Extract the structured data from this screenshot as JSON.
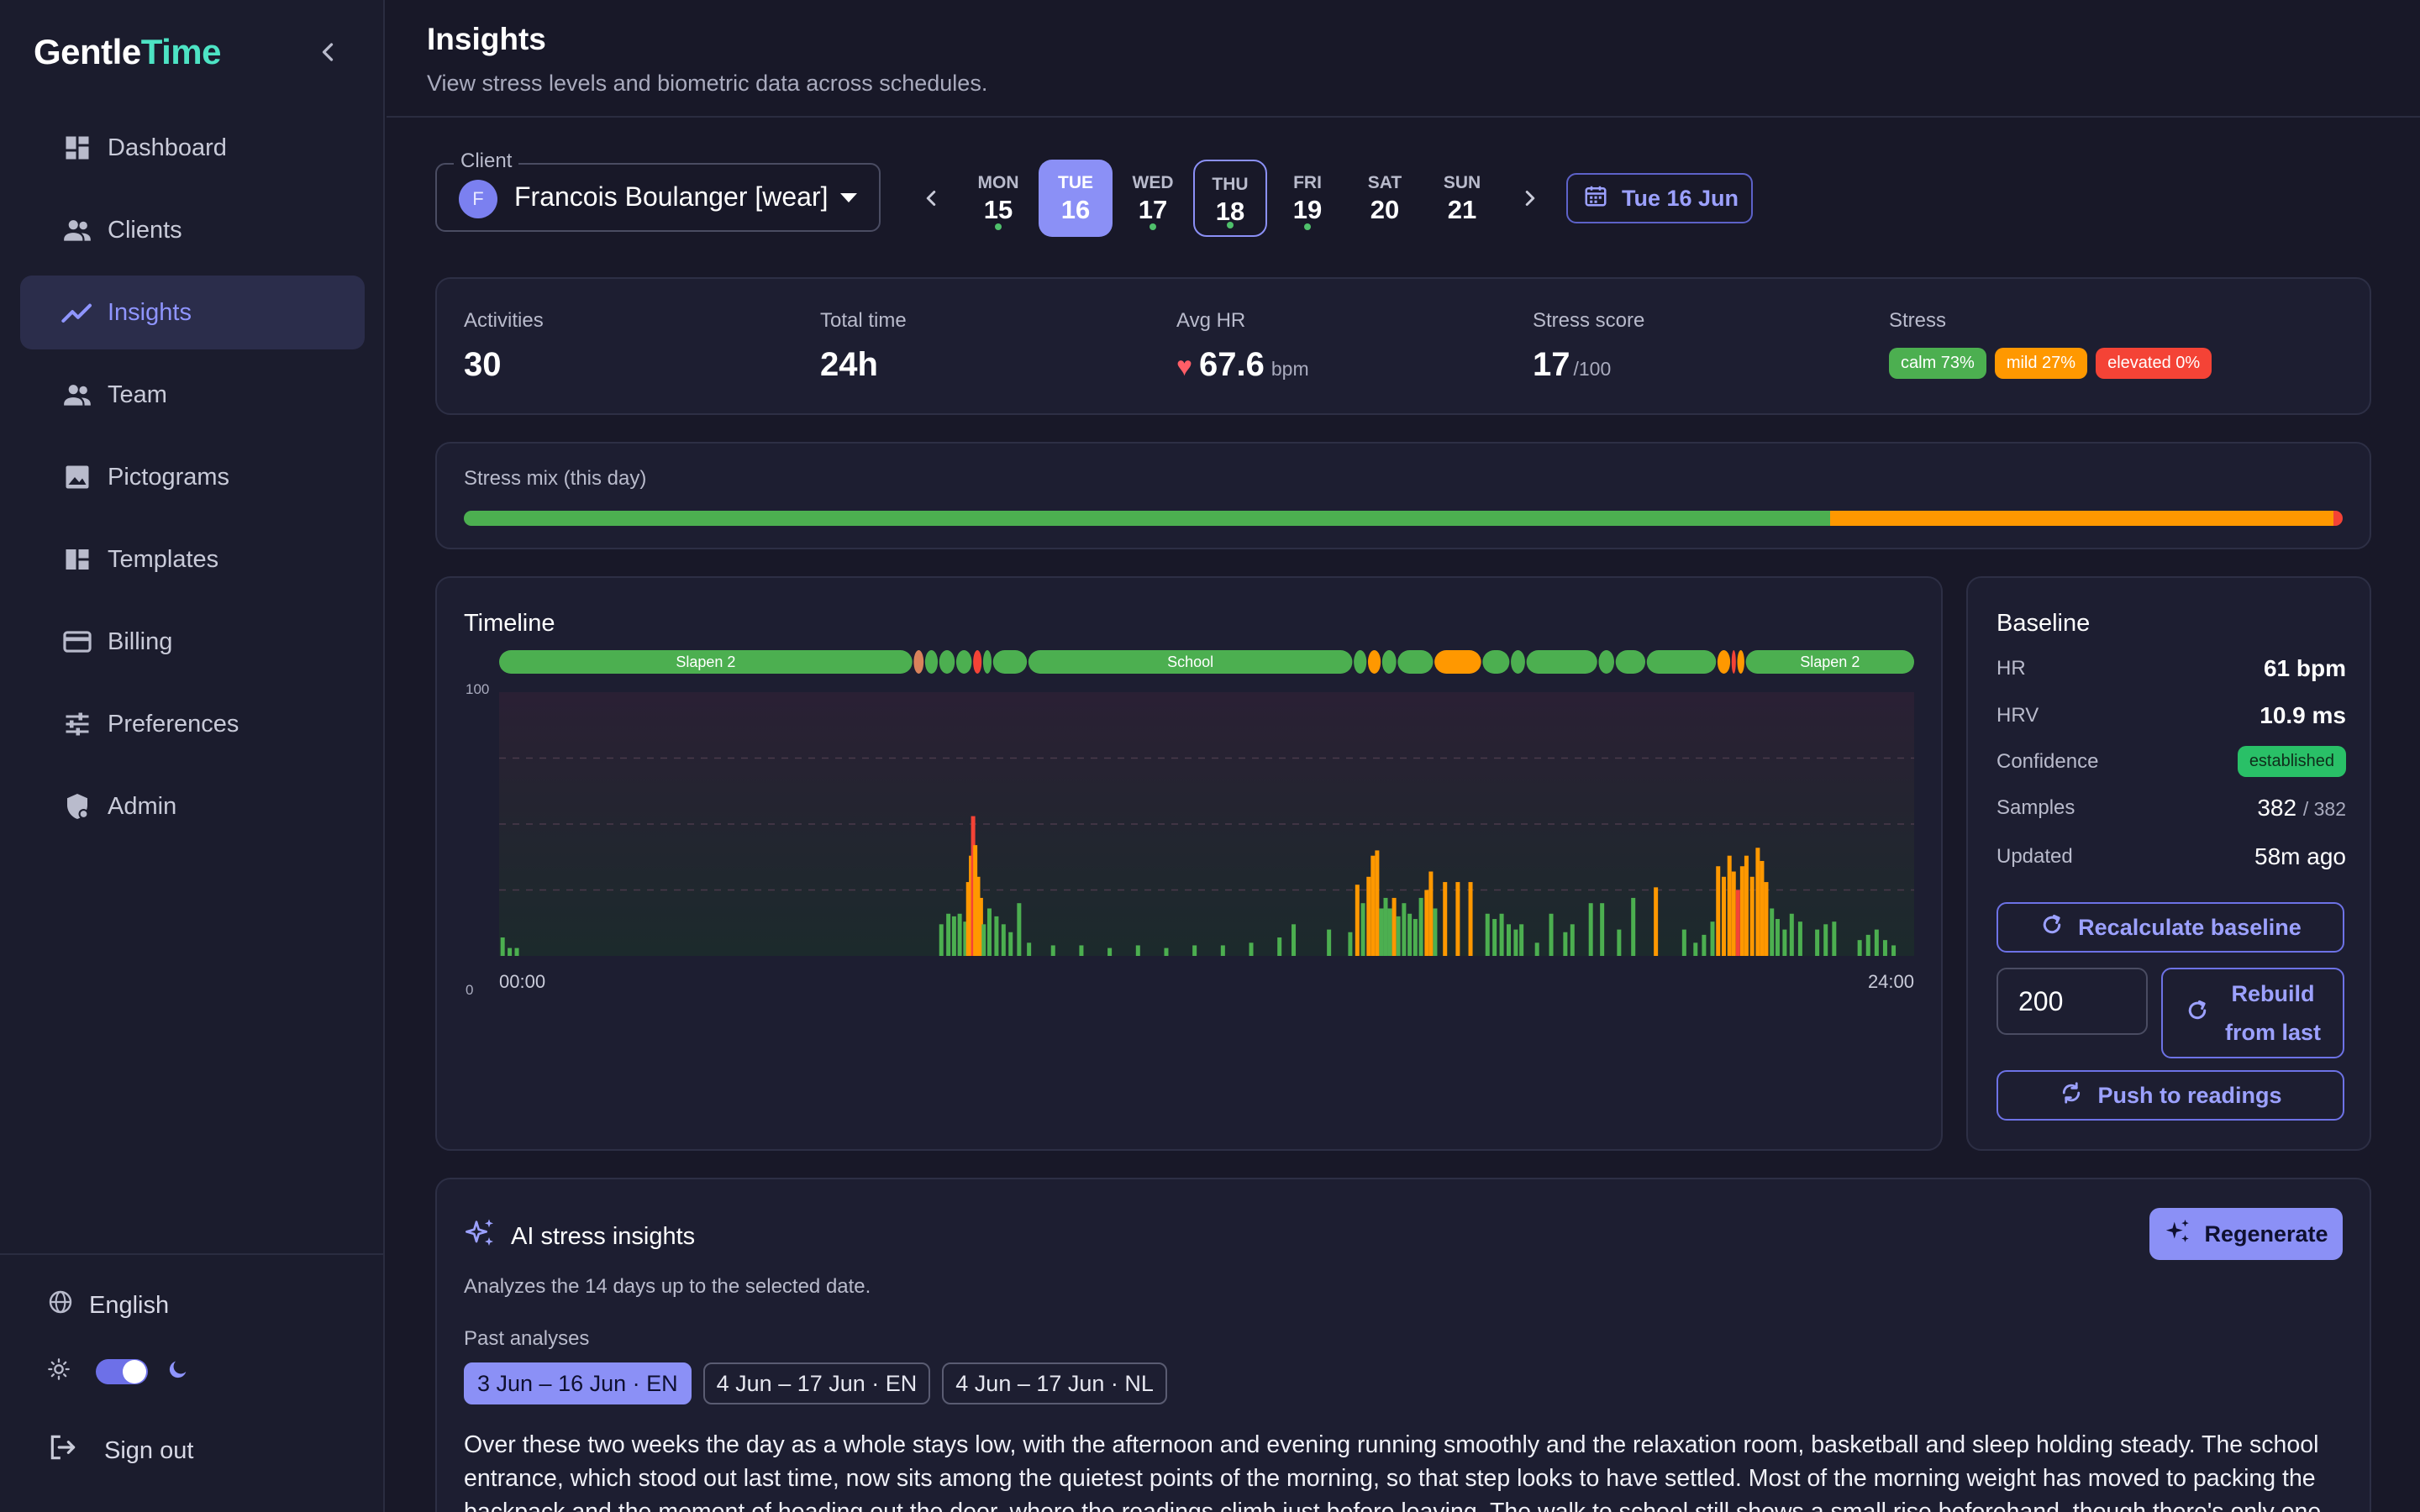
{
  "brand": {
    "part1": "Gentle",
    "part2": "Time"
  },
  "sidebar": {
    "items": [
      {
        "label": "Dashboard",
        "icon": "dashboard-icon"
      },
      {
        "label": "Clients",
        "icon": "people-icon"
      },
      {
        "label": "Insights",
        "icon": "trend-icon",
        "active": true
      },
      {
        "label": "Team",
        "icon": "people-icon"
      },
      {
        "label": "Pictograms",
        "icon": "image-icon"
      },
      {
        "label": "Templates",
        "icon": "templates-icon"
      },
      {
        "label": "Billing",
        "icon": "card-icon"
      },
      {
        "label": "Preferences",
        "icon": "sliders-icon"
      },
      {
        "label": "Admin",
        "icon": "shield-icon"
      }
    ],
    "language": "English",
    "sign_out": "Sign out"
  },
  "header": {
    "title": "Insights",
    "subtitle": "View stress levels and biometric data across schedules."
  },
  "client": {
    "label": "Client",
    "initial": "F",
    "name": "Francois Boulanger [wear]"
  },
  "week": {
    "days": [
      {
        "name": "MON",
        "date": "15",
        "dot": true
      },
      {
        "name": "TUE",
        "date": "16",
        "dot": false,
        "selected": true
      },
      {
        "name": "WED",
        "date": "17",
        "dot": true
      },
      {
        "name": "THU",
        "date": "18",
        "dot": true,
        "today": true
      },
      {
        "name": "FRI",
        "date": "19",
        "dot": true
      },
      {
        "name": "SAT",
        "date": "20",
        "dot": false
      },
      {
        "name": "SUN",
        "date": "21",
        "dot": false
      }
    ],
    "current_date": "Tue 16 Jun"
  },
  "stats": {
    "activities": {
      "label": "Activities",
      "value": "30"
    },
    "total_time": {
      "label": "Total time",
      "value": "24h"
    },
    "avg_hr": {
      "label": "Avg HR",
      "value": "67.6",
      "unit": "bpm"
    },
    "stress_score": {
      "label": "Stress score",
      "value": "17",
      "unit": "/100"
    },
    "stress": {
      "label": "Stress",
      "calm": "calm 73%",
      "mild": "mild 27%",
      "elevated": "elevated 0%"
    }
  },
  "colors": {
    "calm": "#4caf50",
    "mild": "#ff9800",
    "elevated": "#f44336",
    "accent": "#8b90f6",
    "brand_accent": "#4de3c4"
  },
  "stress_mix": {
    "title": "Stress mix (this day)",
    "segments": [
      {
        "level": "calm",
        "fraction": 0.727
      },
      {
        "level": "mild",
        "fraction": 0.268
      },
      {
        "level": "elevated",
        "fraction": 0.005
      }
    ]
  },
  "timeline": {
    "title": "Timeline",
    "y_max_label": "100",
    "y_min_label": "0",
    "x_start": "00:00",
    "x_end": "24:00",
    "activities": [
      {
        "start": 0.0,
        "end": 0.292,
        "level": "calm",
        "label": "Slapen 2"
      },
      {
        "start": 0.293,
        "end": 0.3,
        "level": "mildpale",
        "label": ""
      },
      {
        "start": 0.301,
        "end": 0.31,
        "level": "calm",
        "label": ""
      },
      {
        "start": 0.311,
        "end": 0.322,
        "level": "calm",
        "label": ""
      },
      {
        "start": 0.323,
        "end": 0.334,
        "level": "calm",
        "label": ""
      },
      {
        "start": 0.335,
        "end": 0.341,
        "level": "elevated",
        "label": ""
      },
      {
        "start": 0.342,
        "end": 0.348,
        "level": "calm",
        "label": ""
      },
      {
        "start": 0.349,
        "end": 0.373,
        "level": "calm",
        "label": ""
      },
      {
        "start": 0.374,
        "end": 0.603,
        "level": "calm",
        "label": "School"
      },
      {
        "start": 0.604,
        "end": 0.613,
        "level": "calm",
        "label": ""
      },
      {
        "start": 0.614,
        "end": 0.623,
        "level": "mild",
        "label": ""
      },
      {
        "start": 0.624,
        "end": 0.634,
        "level": "calm",
        "label": ""
      },
      {
        "start": 0.635,
        "end": 0.66,
        "level": "calm",
        "label": ""
      },
      {
        "start": 0.661,
        "end": 0.694,
        "level": "mild",
        "label": ""
      },
      {
        "start": 0.695,
        "end": 0.714,
        "level": "calm",
        "label": ""
      },
      {
        "start": 0.715,
        "end": 0.725,
        "level": "calm",
        "label": ""
      },
      {
        "start": 0.726,
        "end": 0.776,
        "level": "calm",
        "label": ""
      },
      {
        "start": 0.777,
        "end": 0.788,
        "level": "calm",
        "label": ""
      },
      {
        "start": 0.789,
        "end": 0.81,
        "level": "calm",
        "label": ""
      },
      {
        "start": 0.811,
        "end": 0.86,
        "level": "calm",
        "label": ""
      },
      {
        "start": 0.861,
        "end": 0.87,
        "level": "mild",
        "label": ""
      },
      {
        "start": 0.871,
        "end": 0.874,
        "level": "elevated",
        "label": ""
      },
      {
        "start": 0.875,
        "end": 0.88,
        "level": "mild",
        "label": ""
      },
      {
        "start": 0.881,
        "end": 1.0,
        "level": "calm",
        "label": "Slapen 2"
      }
    ],
    "bars": [
      {
        "t": 0.001,
        "v": 7,
        "level": "calm"
      },
      {
        "t": 0.006,
        "v": 3,
        "level": "calm"
      },
      {
        "t": 0.011,
        "v": 3,
        "level": "calm"
      },
      {
        "t": 0.311,
        "v": 12,
        "level": "calm"
      },
      {
        "t": 0.316,
        "v": 16,
        "level": "calm"
      },
      {
        "t": 0.32,
        "v": 15,
        "level": "calm"
      },
      {
        "t": 0.324,
        "v": 16,
        "level": "calm"
      },
      {
        "t": 0.328,
        "v": 13,
        "level": "calm"
      },
      {
        "t": 0.33,
        "v": 28,
        "level": "mild"
      },
      {
        "t": 0.332,
        "v": 38,
        "level": "mild"
      },
      {
        "t": 0.3335,
        "v": 53,
        "level": "elevated"
      },
      {
        "t": 0.335,
        "v": 42,
        "level": "mild"
      },
      {
        "t": 0.337,
        "v": 30,
        "level": "mild"
      },
      {
        "t": 0.339,
        "v": 22,
        "level": "mild"
      },
      {
        "t": 0.341,
        "v": 12,
        "level": "calm"
      },
      {
        "t": 0.345,
        "v": 18,
        "level": "calm"
      },
      {
        "t": 0.35,
        "v": 15,
        "level": "calm"
      },
      {
        "t": 0.355,
        "v": 12,
        "level": "calm"
      },
      {
        "t": 0.36,
        "v": 9,
        "level": "calm"
      },
      {
        "t": 0.366,
        "v": 20,
        "level": "calm"
      },
      {
        "t": 0.373,
        "v": 5,
        "level": "calm"
      },
      {
        "t": 0.39,
        "v": 4,
        "level": "calm"
      },
      {
        "t": 0.41,
        "v": 4,
        "level": "calm"
      },
      {
        "t": 0.43,
        "v": 3,
        "level": "calm"
      },
      {
        "t": 0.45,
        "v": 4,
        "level": "calm"
      },
      {
        "t": 0.47,
        "v": 3,
        "level": "calm"
      },
      {
        "t": 0.49,
        "v": 4,
        "level": "calm"
      },
      {
        "t": 0.51,
        "v": 4,
        "level": "calm"
      },
      {
        "t": 0.53,
        "v": 5,
        "level": "calm"
      },
      {
        "t": 0.55,
        "v": 7,
        "level": "calm"
      },
      {
        "t": 0.56,
        "v": 12,
        "level": "calm"
      },
      {
        "t": 0.585,
        "v": 10,
        "level": "calm"
      },
      {
        "t": 0.6,
        "v": 9,
        "level": "calm"
      },
      {
        "t": 0.605,
        "v": 27,
        "level": "mild"
      },
      {
        "t": 0.609,
        "v": 20,
        "level": "calm"
      },
      {
        "t": 0.613,
        "v": 30,
        "level": "mild"
      },
      {
        "t": 0.616,
        "v": 38,
        "level": "mild"
      },
      {
        "t": 0.619,
        "v": 40,
        "level": "mild"
      },
      {
        "t": 0.622,
        "v": 18,
        "level": "calm"
      },
      {
        "t": 0.625,
        "v": 22,
        "level": "calm"
      },
      {
        "t": 0.628,
        "v": 18,
        "level": "calm"
      },
      {
        "t": 0.631,
        "v": 22,
        "level": "mild"
      },
      {
        "t": 0.634,
        "v": 15,
        "level": "calm"
      },
      {
        "t": 0.638,
        "v": 20,
        "level": "calm"
      },
      {
        "t": 0.642,
        "v": 16,
        "level": "calm"
      },
      {
        "t": 0.646,
        "v": 14,
        "level": "calm"
      },
      {
        "t": 0.65,
        "v": 22,
        "level": "calm"
      },
      {
        "t": 0.654,
        "v": 25,
        "level": "mild"
      },
      {
        "t": 0.657,
        "v": 32,
        "level": "mild"
      },
      {
        "t": 0.66,
        "v": 18,
        "level": "calm"
      },
      {
        "t": 0.667,
        "v": 28,
        "level": "mild"
      },
      {
        "t": 0.676,
        "v": 28,
        "level": "mild"
      },
      {
        "t": 0.685,
        "v": 28,
        "level": "mild"
      },
      {
        "t": 0.697,
        "v": 16,
        "level": "calm"
      },
      {
        "t": 0.702,
        "v": 14,
        "level": "calm"
      },
      {
        "t": 0.707,
        "v": 16,
        "level": "calm"
      },
      {
        "t": 0.712,
        "v": 12,
        "level": "calm"
      },
      {
        "t": 0.717,
        "v": 10,
        "level": "calm"
      },
      {
        "t": 0.721,
        "v": 12,
        "level": "calm"
      },
      {
        "t": 0.732,
        "v": 5,
        "level": "calm"
      },
      {
        "t": 0.742,
        "v": 16,
        "level": "calm"
      },
      {
        "t": 0.752,
        "v": 9,
        "level": "calm"
      },
      {
        "t": 0.757,
        "v": 12,
        "level": "calm"
      },
      {
        "t": 0.77,
        "v": 20,
        "level": "calm"
      },
      {
        "t": 0.778,
        "v": 20,
        "level": "calm"
      },
      {
        "t": 0.79,
        "v": 10,
        "level": "calm"
      },
      {
        "t": 0.8,
        "v": 22,
        "level": "calm"
      },
      {
        "t": 0.816,
        "v": 26,
        "level": "mild"
      },
      {
        "t": 0.836,
        "v": 10,
        "level": "calm"
      },
      {
        "t": 0.844,
        "v": 5,
        "level": "calm"
      },
      {
        "t": 0.85,
        "v": 8,
        "level": "calm"
      },
      {
        "t": 0.856,
        "v": 13,
        "level": "calm"
      },
      {
        "t": 0.86,
        "v": 34,
        "level": "mild"
      },
      {
        "t": 0.864,
        "v": 30,
        "level": "mild"
      },
      {
        "t": 0.868,
        "v": 38,
        "level": "mild"
      },
      {
        "t": 0.871,
        "v": 32,
        "level": "mild"
      },
      {
        "t": 0.874,
        "v": 25,
        "level": "elevated"
      },
      {
        "t": 0.877,
        "v": 34,
        "level": "mild"
      },
      {
        "t": 0.88,
        "v": 38,
        "level": "mild"
      },
      {
        "t": 0.884,
        "v": 30,
        "level": "mild"
      },
      {
        "t": 0.888,
        "v": 41,
        "level": "mild"
      },
      {
        "t": 0.891,
        "v": 36,
        "level": "mild"
      },
      {
        "t": 0.894,
        "v": 28,
        "level": "mild"
      },
      {
        "t": 0.898,
        "v": 18,
        "level": "calm"
      },
      {
        "t": 0.902,
        "v": 14,
        "level": "calm"
      },
      {
        "t": 0.907,
        "v": 10,
        "level": "calm"
      },
      {
        "t": 0.912,
        "v": 16,
        "level": "calm"
      },
      {
        "t": 0.918,
        "v": 13,
        "level": "calm"
      },
      {
        "t": 0.93,
        "v": 10,
        "level": "calm"
      },
      {
        "t": 0.936,
        "v": 12,
        "level": "calm"
      },
      {
        "t": 0.942,
        "v": 13,
        "level": "calm"
      },
      {
        "t": 0.96,
        "v": 6,
        "level": "calm"
      },
      {
        "t": 0.966,
        "v": 8,
        "level": "calm"
      },
      {
        "t": 0.972,
        "v": 10,
        "level": "calm"
      },
      {
        "t": 0.978,
        "v": 6,
        "level": "calm"
      },
      {
        "t": 0.984,
        "v": 4,
        "level": "calm"
      }
    ]
  },
  "baseline": {
    "title": "Baseline",
    "hr": {
      "label": "HR",
      "value": "61 bpm"
    },
    "hrv": {
      "label": "HRV",
      "value": "10.9 ms"
    },
    "confidence": {
      "label": "Confidence",
      "value": "established"
    },
    "samples": {
      "label": "Samples",
      "value": "382",
      "total": "/ 382"
    },
    "updated": {
      "label": "Updated",
      "value": "58m ago"
    },
    "recalculate": "Recalculate baseline",
    "rebuild_count": "200",
    "rebuild_line1": "Rebuild",
    "rebuild_line2": "from last",
    "push": "Push to readings"
  },
  "ai": {
    "title": "AI stress insights",
    "regenerate": "Regenerate",
    "description": "Analyzes the 14 days up to the selected date.",
    "past_label": "Past analyses",
    "past": [
      {
        "label": "3 Jun – 16 Jun · EN",
        "active": true
      },
      {
        "label": "4 Jun – 17 Jun · EN",
        "active": false
      },
      {
        "label": "4 Jun – 17 Jun · NL",
        "active": false
      }
    ],
    "text": "Over these two weeks the day as a whole stays low, with the afternoon and evening running smoothly and the relaxation room, basketball and sleep holding steady. The school entrance, which stood out last time, now sits among the quietest points of the morning, so that step looks to have settled. Most of the morning weight has moved to packing the backpack and the moment of heading out the door, where the readings climb just before leaving. The walk to school still shows a small rise beforehand, though there's only one day"
  }
}
